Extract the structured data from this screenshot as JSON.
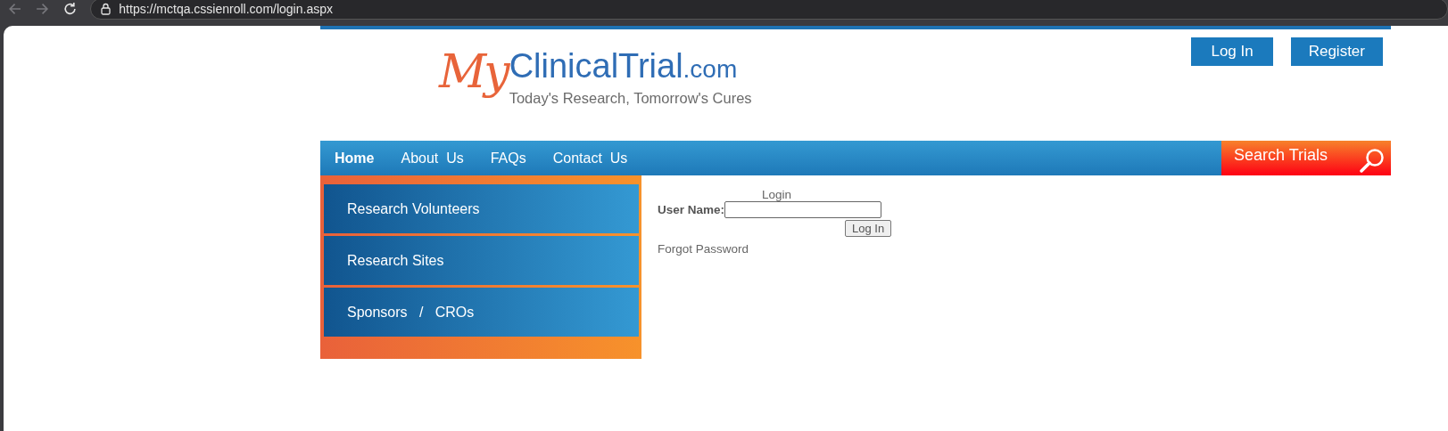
{
  "browser": {
    "url": "https://mctqa.cssienroll.com/login.aspx"
  },
  "header": {
    "logo": {
      "script": "My",
      "name": "ClinicalTrial",
      "suffix": ".com",
      "tagline": "Today's Research, Tomorrow's Cures"
    },
    "buttons": [
      "Log In",
      "Register"
    ]
  },
  "nav": {
    "items": [
      {
        "label": "Home",
        "selected": true
      },
      {
        "label": "About  Us",
        "selected": false
      },
      {
        "label": "FAQs",
        "selected": false
      },
      {
        "label": "Contact  Us",
        "selected": false
      }
    ],
    "search": "Search Trials"
  },
  "sidebar": {
    "items": [
      "Research Volunteers",
      "Research Sites",
      "Sponsors   /   CROs"
    ]
  },
  "login": {
    "title": "Login",
    "username_label": "User Name:",
    "button": "Log In",
    "forgot": "Forgot Password"
  }
}
